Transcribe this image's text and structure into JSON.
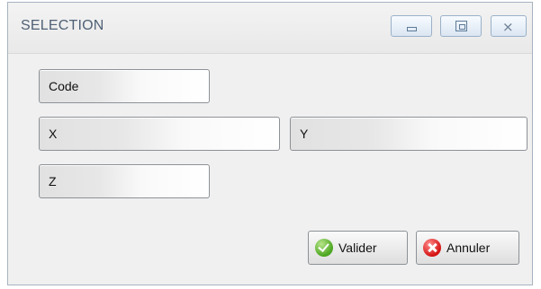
{
  "window": {
    "title": "SELECTION",
    "controls": {
      "minimize_icon": "minimize-icon",
      "maximize_icon": "maximize-icon",
      "close_icon": "close-icon",
      "close_glyph": "⨯"
    }
  },
  "fields": {
    "code": {
      "label": "Code"
    },
    "x": {
      "label": "X"
    },
    "y": {
      "label": "Y"
    },
    "z": {
      "label": "Z"
    }
  },
  "actions": {
    "valider": {
      "label": "Valider",
      "icon": "check-circle-icon",
      "color": "#4aa51f"
    },
    "annuler": {
      "label": "Annuler",
      "icon": "cancel-circle-icon",
      "color": "#d41313"
    }
  },
  "colors": {
    "title_text": "#4f6176",
    "window_bg": "#f0f0f0",
    "border": "#8d9196"
  }
}
